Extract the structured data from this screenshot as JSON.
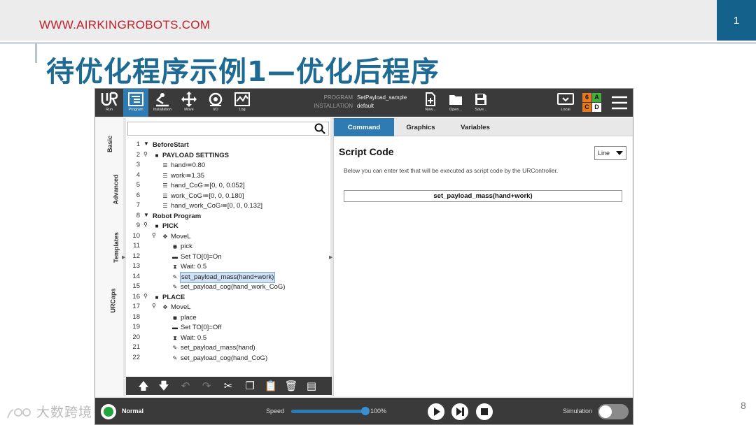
{
  "slide": {
    "url": "WWW.AIRKINGROBOTS.COM",
    "page_box": "1",
    "title": "待优化程序示例1—优化后程序",
    "page_number": "8",
    "watermark": "大数跨境"
  },
  "topbar": {
    "buttons": [
      {
        "label": "Run",
        "icon": "ur-logo-icon"
      },
      {
        "label": "Program",
        "icon": "program-icon",
        "active": true
      },
      {
        "label": "Installation",
        "icon": "installation-icon"
      },
      {
        "label": "Move",
        "icon": "move-icon"
      },
      {
        "label": "I/O",
        "icon": "io-icon"
      },
      {
        "label": "Log",
        "icon": "log-icon"
      }
    ],
    "program_key": "PROGRAM",
    "program_value": "SetPayload_sample",
    "installation_key": "INSTALLATION",
    "installation_value": "default",
    "file_buttons": [
      {
        "label": "New...",
        "icon": "new-file-icon"
      },
      {
        "label": "Open...",
        "icon": "folder-icon"
      },
      {
        "label": "Save...",
        "icon": "save-icon"
      }
    ],
    "local_label": "Local",
    "safety": {
      "a": "6",
      "b": "A",
      "c": "C",
      "d": "D"
    },
    "menu_icon": "hamburger-menu-icon",
    "colors": {
      "active_tab": "#2e7ab3",
      "topbar_bg": "#3a3a3a"
    }
  },
  "side_tabs": [
    "Basic",
    "Advanced",
    "Templates",
    "URCaps"
  ],
  "tree": {
    "search_placeholder": "",
    "rows": [
      {
        "n": "1",
        "text": "BeforeStart",
        "level": 0,
        "icon": "",
        "expander": "▼",
        "bold": true
      },
      {
        "n": "2",
        "text": "PAYLOAD SETTINGS",
        "level": 1,
        "icon": "folder-icon",
        "expander": "⚲",
        "bold": true
      },
      {
        "n": "3",
        "text": "hand≔0.80",
        "level": 2,
        "icon": "assignment-icon"
      },
      {
        "n": "4",
        "text": "work≔1.35",
        "level": 2,
        "icon": "assignment-icon"
      },
      {
        "n": "5",
        "text": "hand_CoG≔[0, 0, 0.052]",
        "level": 2,
        "icon": "assignment-icon"
      },
      {
        "n": "6",
        "text": "work_CoG≔[0, 0, 0.180]",
        "level": 2,
        "icon": "assignment-icon"
      },
      {
        "n": "7",
        "text": "hand_work_CoG≔[0, 0, 0.132]",
        "level": 2,
        "icon": "assignment-icon"
      },
      {
        "n": "8",
        "text": "Robot Program",
        "level": 0,
        "icon": "",
        "expander": "▼",
        "bold": true
      },
      {
        "n": "9",
        "text": "PICK",
        "level": 1,
        "icon": "folder-icon",
        "expander": "⚲",
        "bold": true
      },
      {
        "n": "10",
        "text": "MoveL",
        "level": 2,
        "icon": "move-cross-icon",
        "expander": "⚲"
      },
      {
        "n": "11",
        "text": "pick",
        "level": 3,
        "icon": "waypoint-icon"
      },
      {
        "n": "12",
        "text": "Set TO[0]=On",
        "level": 3,
        "icon": "set-icon"
      },
      {
        "n": "13",
        "text": "Wait: 0.5",
        "level": 3,
        "icon": "hourglass-icon"
      },
      {
        "n": "14",
        "text": "set_payload_mass(hand+work)",
        "level": 3,
        "icon": "script-icon",
        "selected": true
      },
      {
        "n": "15",
        "text": "set_payload_cog(hand_work_CoG)",
        "level": 3,
        "icon": "script-icon"
      },
      {
        "n": "16",
        "text": "PLACE",
        "level": 1,
        "icon": "folder-icon",
        "expander": "⚲",
        "bold": true
      },
      {
        "n": "17",
        "text": "MoveL",
        "level": 2,
        "icon": "move-cross-icon",
        "expander": "⚲"
      },
      {
        "n": "18",
        "text": "place",
        "level": 3,
        "icon": "waypoint-icon"
      },
      {
        "n": "19",
        "text": "Set TO[0]=Off",
        "level": 3,
        "icon": "set-icon"
      },
      {
        "n": "20",
        "text": "Wait: 0.5",
        "level": 3,
        "icon": "hourglass-icon"
      },
      {
        "n": "21",
        "text": "set_payload_mass(hand)",
        "level": 3,
        "icon": "script-icon"
      },
      {
        "n": "22",
        "text": "set_payload_cog(hand_CoG)",
        "level": 3,
        "icon": "script-icon"
      }
    ],
    "toolbar": [
      "move-up-icon",
      "move-down-icon",
      "undo-icon",
      "redo-icon",
      "cut-icon",
      "copy-icon",
      "paste-icon",
      "delete-icon",
      "suppress-icon"
    ]
  },
  "command": {
    "tabs": [
      {
        "label": "Command",
        "active": true
      },
      {
        "label": "Graphics"
      },
      {
        "label": "Variables"
      }
    ],
    "title": "Script Code",
    "dropdown_value": "Line",
    "description": "Below you can enter text that will be executed as script code by the URController.",
    "script_value": "set_payload_mass(hand+work)"
  },
  "footer": {
    "status": "Normal",
    "speed_label": "Speed",
    "speed_value": "100%",
    "speed_fraction": 1.0,
    "simulation_label": "Simulation",
    "simulation_on": false,
    "status_color": "#22a53a"
  }
}
